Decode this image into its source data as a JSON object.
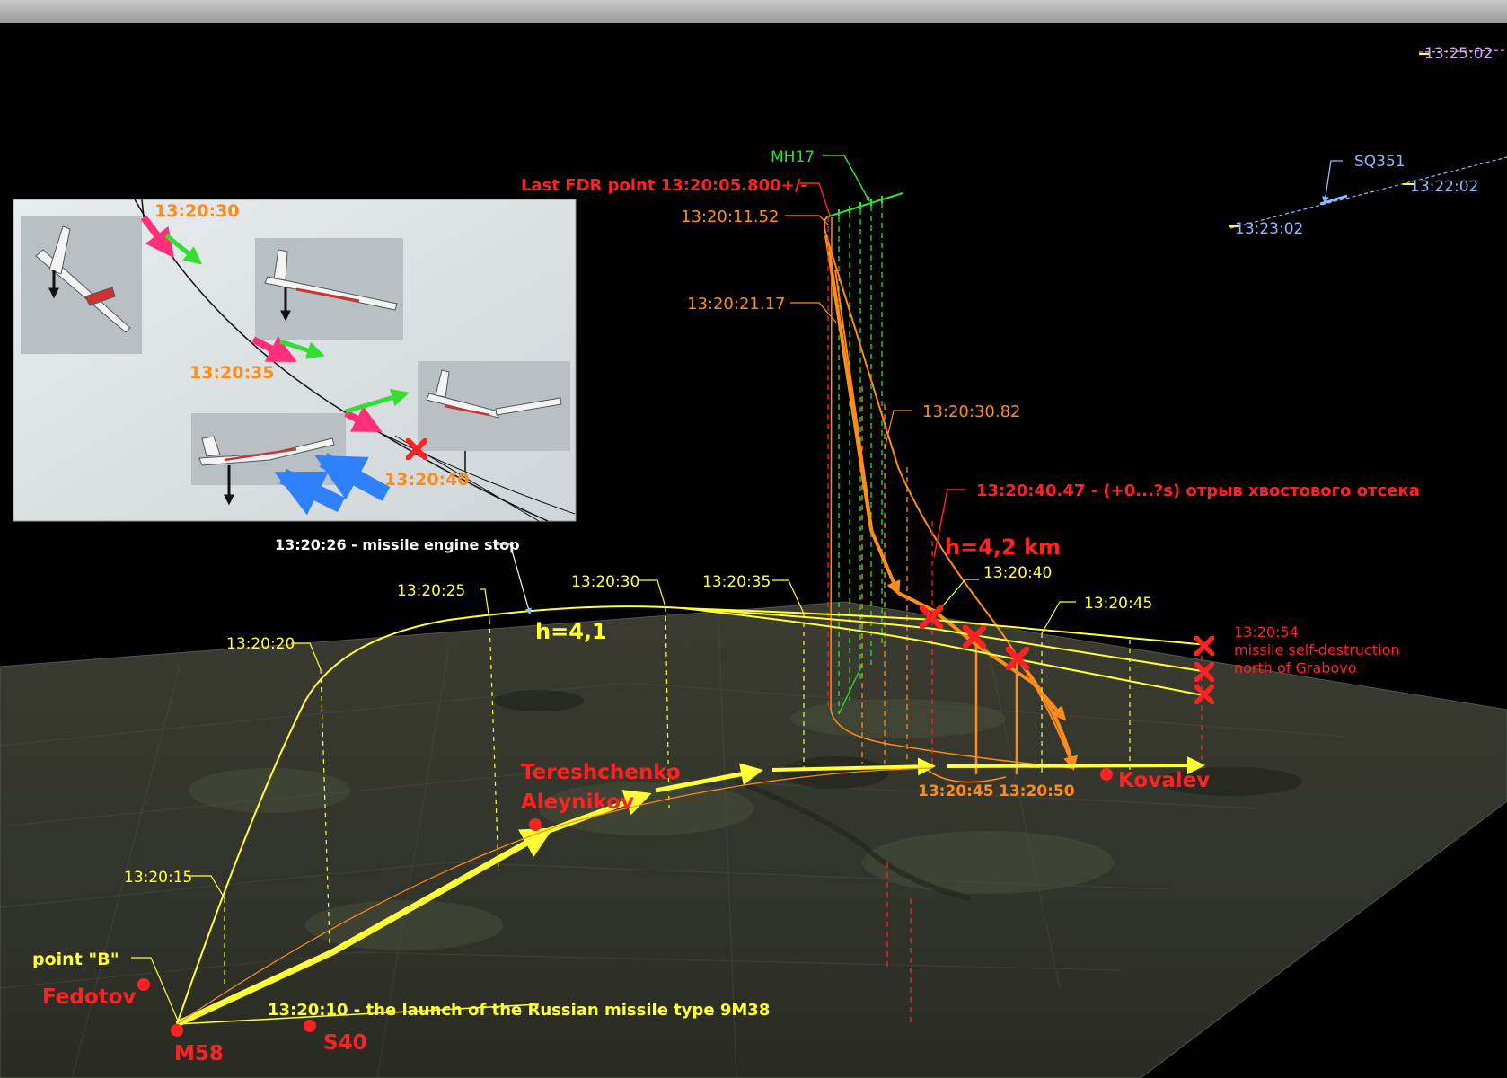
{
  "colors": {
    "missile": "#ffff33",
    "mh17_fall": "#ff8c1a",
    "mh17_track": "#33dd33",
    "red": "#ff2222",
    "sq351": "#8fb8ff",
    "inset_pink": "#ff2f7a",
    "inset_green": "#33dd33",
    "inset_blue": "#2f80ff"
  },
  "tracks": {
    "mh17": "MH17",
    "last_fdr": "Last FDR point 13:20:05.800+/-",
    "sq351": "SQ351",
    "t_1325": "13:25:02",
    "t_1322": "13:22:02",
    "t_1323": "13:23:02"
  },
  "fall_times": {
    "t_1152": "13:20:11.52",
    "t_2117": "13:20:21.17",
    "t_3082": "13:20:30.82",
    "breakup": "13:20:40.47 - (+0...?s) отрыв хвостового отсека",
    "altitude": "h=4,2 km",
    "t_40": "13:20:40",
    "t_45_ground": "13:20:45",
    "t_50_ground": "13:20:50"
  },
  "missile": {
    "engine_stop": "13:20:26 - missile engine stop",
    "h": "h=4,1",
    "t_15": "13:20:15",
    "t_20": "13:20:20",
    "t_25": "13:20:25",
    "t_30": "13:20:30",
    "t_35": "13:20:35",
    "t_45": "13:20:45",
    "t_54": "13:20:54",
    "self_destruct_1": "missile self-destruction",
    "self_destruct_2": "north of Grabovo",
    "launch": "13:20:10 - the launch of the Russian missile type 9M38",
    "point_b": "point \"B\""
  },
  "places": {
    "fedotov": "Fedotov",
    "m58": "M58",
    "s40": "S40",
    "tereshchenko": "Tereshchenko",
    "aleynikov": "Aleynikov",
    "kovalev": "Kovalev"
  },
  "inset": {
    "t_30": "13:20:30",
    "t_35": "13:20:35",
    "t_40": "13:20:40"
  }
}
